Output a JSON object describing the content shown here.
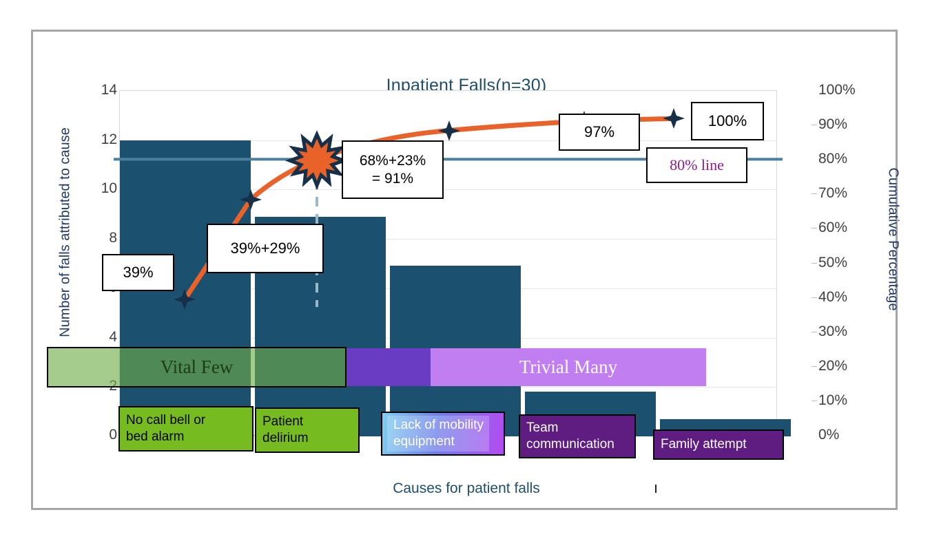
{
  "chart_data": {
    "type": "bar",
    "title": "Inpatient Falls(n=30)",
    "xlabel": "Causes for patient falls",
    "ylabel": "Number of falls attributed to cause",
    "y2label": "Cumulative Percentage",
    "ylim": [
      0,
      14
    ],
    "y2lim": [
      0,
      100
    ],
    "grid": true,
    "legend": null,
    "categories": [
      "No call bell or bed alarm",
      "Patient delirium",
      "Lack of mobility equipment",
      "Team communication",
      "Family attempt"
    ],
    "series": [
      {
        "name": "Number of falls attributed to cause",
        "type": "bar",
        "values": [
          12,
          8.9,
          6.9,
          1.8,
          0.7
        ]
      },
      {
        "name": "Cumulative Percentage",
        "type": "line",
        "values": [
          39,
          68,
          91,
          97,
          100
        ]
      }
    ],
    "reference_line": {
      "label": "80% line",
      "value": 80,
      "color": "#4a7f9e"
    },
    "y_ticks": [
      "0",
      "2",
      "4",
      "6",
      "8",
      "10",
      "12",
      "14"
    ],
    "y2_ticks": [
      "0%",
      "10%",
      "20%",
      "30%",
      "40%",
      "50%",
      "60%",
      "70%",
      "80%",
      "90%",
      "100%"
    ],
    "annotations": [
      "39%",
      "39%+29%",
      "68%+23% = 91%",
      "97%",
      "100%",
      "80% line"
    ]
  },
  "chart": {
    "title": "Inpatient Falls(n=30)",
    "x_axis_title": "Causes for patient falls",
    "y_left_title": "Number of falls attributed to cause",
    "y_right_title": "Cumulative Percentage",
    "y_left_ticks": [
      "14",
      "12",
      "10",
      "8",
      "6",
      "4",
      "2",
      "0"
    ],
    "y_right_ticks": [
      "100%",
      "90%",
      "80%",
      "70%",
      "60%",
      "50%",
      "40%",
      "30%",
      "20%",
      "10%",
      "0%"
    ]
  },
  "callouts": {
    "first": "39%",
    "second": "39%+29%",
    "third_line1": "68%+23%",
    "third_line2": "= 91%",
    "fourth": "97%",
    "fifth": "100%",
    "reference": "80% line"
  },
  "bands": {
    "vital_few": "Vital Few",
    "trivial_many": "Trivial Many"
  },
  "category_labels": [
    {
      "line1": "No call bell or",
      "line2": "bed alarm"
    },
    {
      "line1": "Patient",
      "line2": "delirium"
    },
    {
      "line1": "Lack of mobility",
      "line2": "equipment"
    },
    {
      "line1": "Team",
      "line2": "communication"
    },
    {
      "line1": "Family attempt",
      "line2": ""
    }
  ],
  "colors": {
    "bar": "#1b506f",
    "line": "#e8622a",
    "reference_line": "#4a7f9e",
    "vital_few": "#70ad47",
    "trivial_many": "#c07ef0",
    "callout_reference_text": "#8f1a8f",
    "title": "#1f4e6a"
  }
}
